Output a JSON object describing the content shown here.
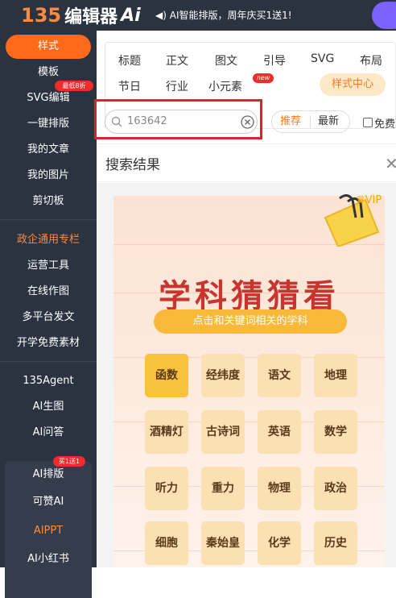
{
  "topbar": {
    "logo_num": "135",
    "logo_text": "编辑器",
    "logo_ai": "Ai",
    "announcement": "AI智能排版，周年庆买1送1!"
  },
  "sidebar": {
    "items": [
      "样式",
      "模板",
      "SVG编辑",
      "一键排版",
      "我的文章",
      "我的图片",
      "剪切板",
      "政企通用专栏",
      "运营工具",
      "在线作图",
      "多平台发文",
      "开学免费素材",
      "135Agent",
      "AI生图",
      "AI问答",
      "AI排版",
      "可赞AI",
      "AIPPT",
      "AI小红书"
    ],
    "badge_svg": "最低8折",
    "badge_ai": "买1送1"
  },
  "categories": {
    "row1": [
      "标题",
      "正文",
      "图文",
      "引导",
      "SVG",
      "布局"
    ],
    "row2": [
      "节日",
      "行业",
      "小元素"
    ],
    "new_badge": "new",
    "style_center": "样式中心"
  },
  "search": {
    "value": "163642",
    "tab_recommended": "推荐",
    "tab_latest": "最新",
    "free_label": "免费"
  },
  "results": {
    "title": "搜索结果",
    "vip": "VIP",
    "card_title": "学科猜猜看",
    "card_subtitle": "点击和关键词相关的学科",
    "words": [
      "函数",
      "经纬度",
      "语文",
      "地理",
      "酒精灯",
      "古诗词",
      "英语",
      "数学",
      "听力",
      "重力",
      "物理",
      "政治",
      "细胞",
      "秦始皇",
      "化学",
      "历史"
    ]
  }
}
